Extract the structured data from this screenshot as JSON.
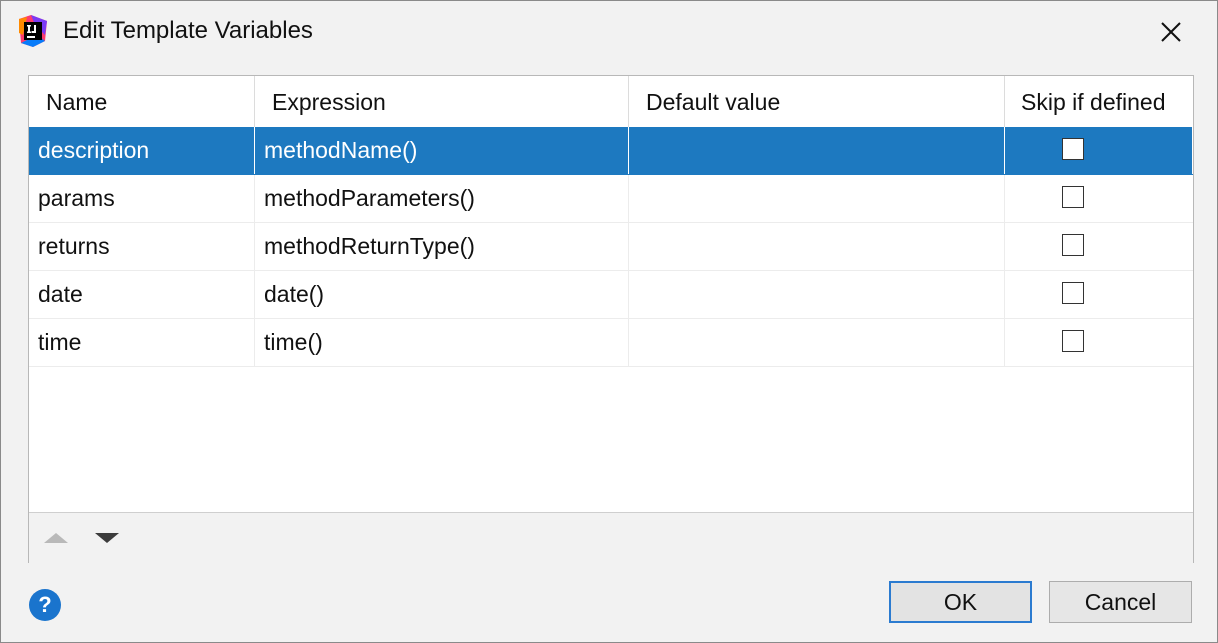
{
  "dialog": {
    "title": "Edit Template Variables"
  },
  "table": {
    "columns": [
      "Name",
      "Expression",
      "Default value",
      "Skip if defined"
    ],
    "rows": [
      {
        "name": "description",
        "expression": "methodName()",
        "default": "",
        "skip": false
      },
      {
        "name": "params",
        "expression": "methodParameters()",
        "default": "",
        "skip": false
      },
      {
        "name": "returns",
        "expression": "methodReturnType()",
        "default": "",
        "skip": false
      },
      {
        "name": "date",
        "expression": "date()",
        "default": "",
        "skip": false
      },
      {
        "name": "time",
        "expression": "time()",
        "default": "",
        "skip": false
      }
    ],
    "selected_row": 0
  },
  "toolbar": {
    "move_up_icon": "triangle-up-icon",
    "move_down_icon": "triangle-down-icon"
  },
  "buttons": {
    "help_label": "?",
    "ok_label": "OK",
    "cancel_label": "Cancel"
  },
  "colors": {
    "selection": "#1d79c0",
    "help": "#1a74cd",
    "ok_border": "#2b7bd0"
  }
}
